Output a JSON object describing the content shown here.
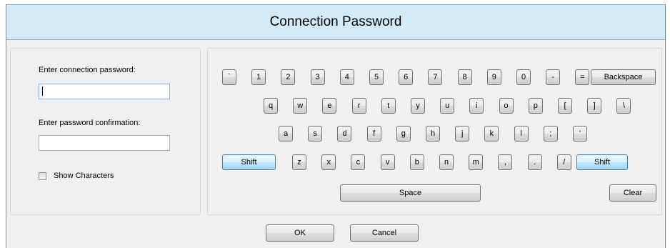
{
  "dialog": {
    "title": "Connection Password"
  },
  "form": {
    "password_label": "Enter connection password:",
    "password_value": "",
    "confirm_label": "Enter password confirmation:",
    "confirm_value": "",
    "show_characters_label": "Show Characters",
    "show_characters_checked": false
  },
  "keyboard": {
    "row1": [
      "`",
      "1",
      "2",
      "3",
      "4",
      "5",
      "6",
      "7",
      "8",
      "9",
      "0",
      "-",
      "="
    ],
    "backspace": "Backspace",
    "row2": [
      "q",
      "w",
      "e",
      "r",
      "t",
      "y",
      "u",
      "i",
      "o",
      "p",
      "[",
      "]",
      "\\"
    ],
    "row3": [
      "a",
      "s",
      "d",
      "f",
      "g",
      "h",
      "j",
      "k",
      "l",
      ";",
      "'"
    ],
    "row4": [
      "z",
      "x",
      "c",
      "v",
      "b",
      "n",
      "m",
      ",",
      ".",
      "/"
    ],
    "shift_left": "Shift",
    "shift_right": "Shift",
    "space": "Space",
    "clear": "Clear"
  },
  "buttons": {
    "ok": "OK",
    "cancel": "Cancel"
  }
}
